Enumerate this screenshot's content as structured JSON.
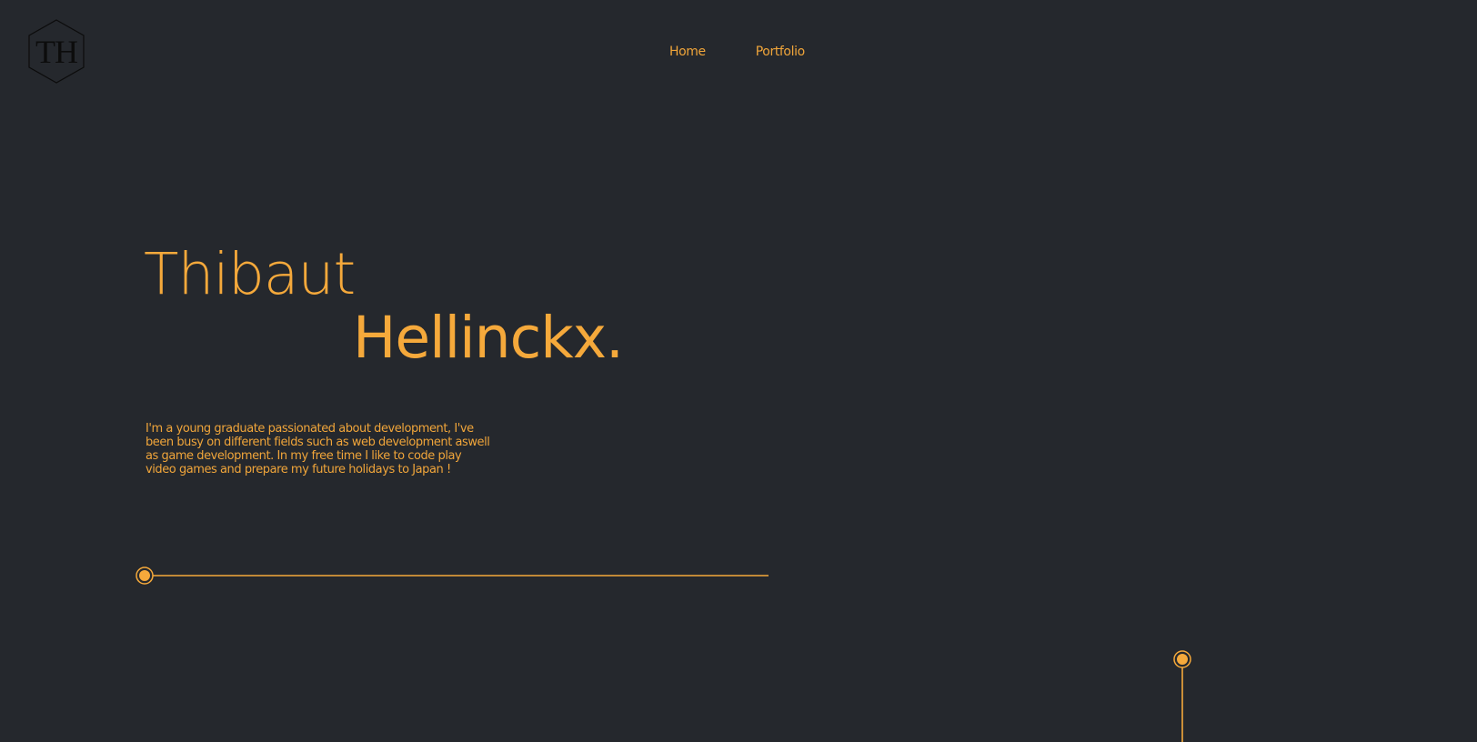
{
  "logo": {
    "text": "TH"
  },
  "nav": {
    "items": [
      {
        "label": "Home"
      },
      {
        "label": "Portfolio"
      }
    ]
  },
  "hero": {
    "first_name": "Thibaut",
    "last_name": "Hellinckx.",
    "bio": "I'm a young graduate passionated about development, I've been busy on different fields such as web development aswell as game development. In my free time I like to code play video games and prepare my future holidays to Japan !"
  },
  "colors": {
    "background": "#25282d",
    "accent": "#f5a93b",
    "logo": "#0c0c0c"
  }
}
